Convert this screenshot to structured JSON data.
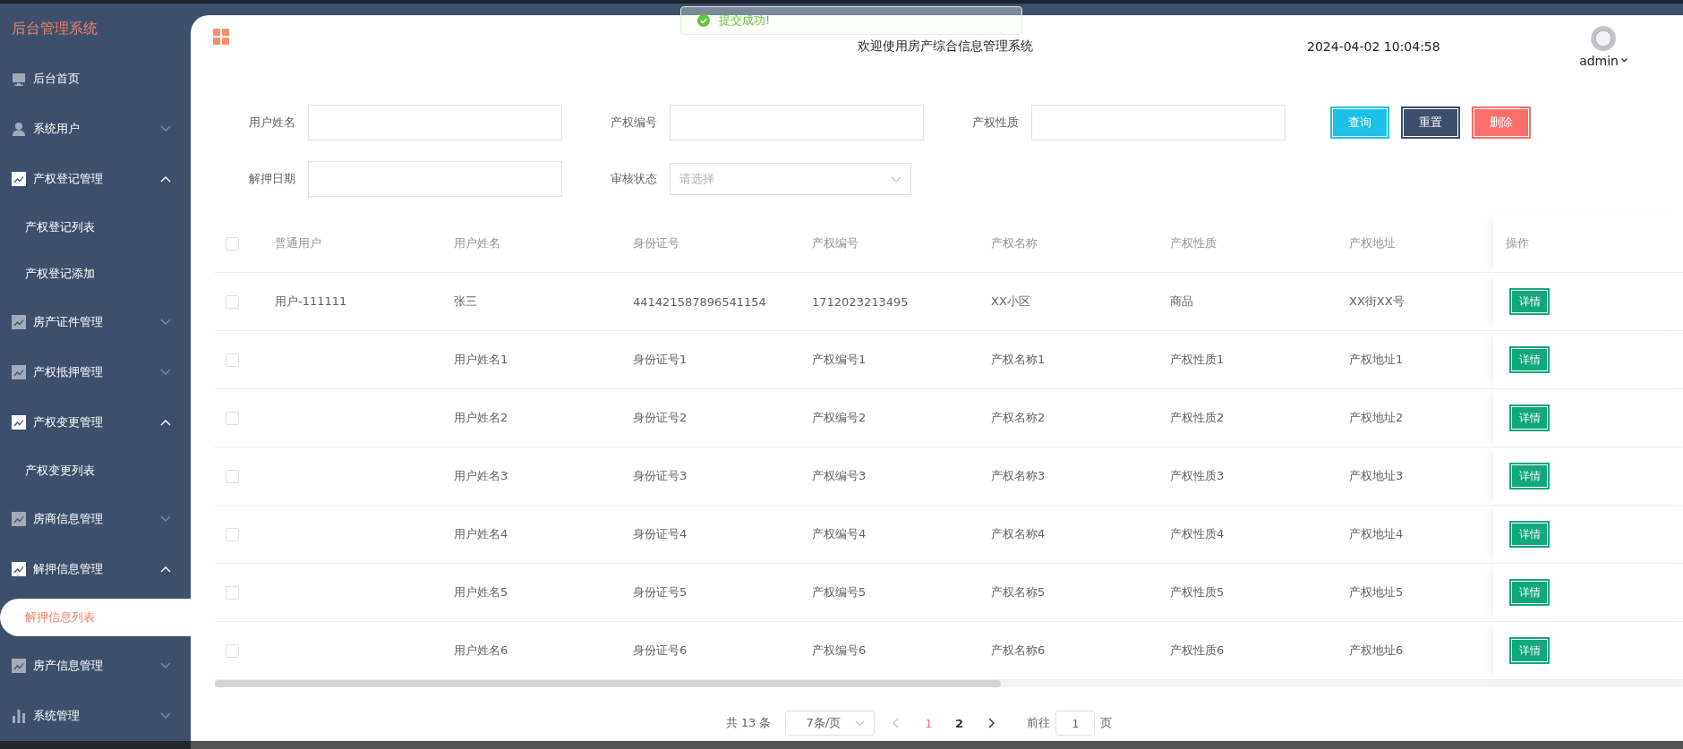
{
  "sidebar": {
    "title": "后台管理系统",
    "items": [
      {
        "label": "后台首页",
        "selected": false
      },
      {
        "label": "系统用户",
        "selected": false,
        "expanded": false
      },
      {
        "label": "产权登记管理",
        "selected": false,
        "expanded": true,
        "children": [
          {
            "label": "产权登记列表",
            "selected": false
          },
          {
            "label": "产权登记添加",
            "selected": false
          }
        ]
      },
      {
        "label": "房产证件管理",
        "selected": false,
        "expanded": false
      },
      {
        "label": "产权抵押管理",
        "selected": false,
        "expanded": false
      },
      {
        "label": "产权变更管理",
        "selected": false,
        "expanded": true,
        "children": [
          {
            "label": "产权变更列表",
            "selected": false
          }
        ]
      },
      {
        "label": "房商信息管理",
        "selected": false,
        "expanded": false
      },
      {
        "label": "解押信息管理",
        "selected": false,
        "expanded": true,
        "children": [
          {
            "label": "解押信息列表",
            "selected": true
          }
        ]
      },
      {
        "label": "房产信息管理",
        "selected": false,
        "expanded": false
      },
      {
        "label": "系统管理",
        "selected": false,
        "expanded": false
      }
    ]
  },
  "header": {
    "title": "欢迎使用房产综合信息管理系统",
    "datetime": "2024-04-02 10:04:58",
    "user": "admin"
  },
  "toast": {
    "message": "提交成功!"
  },
  "filters": [
    {
      "kind": "text",
      "label": "用户姓名"
    },
    {
      "kind": "text",
      "label": "产权编号"
    },
    {
      "kind": "text",
      "label": "产权性质"
    },
    {
      "kind": "text",
      "label": "解押日期"
    },
    {
      "kind": "select",
      "label": "审核状态",
      "placeholder": "请选择"
    }
  ],
  "buttons": [
    {
      "kind": "query",
      "label": "查询"
    },
    {
      "kind": "reset",
      "label": "重置"
    },
    {
      "kind": "delete",
      "label": "删除"
    }
  ],
  "table": {
    "all_checked": false,
    "columns": [
      "普通用户",
      "用户姓名",
      "身份证号",
      "产权编号",
      "产权名称",
      "产权性质",
      "产权地址",
      "操作"
    ],
    "rows": [
      {
        "checked": false,
        "cells": [
          "用户-111111",
          "张三",
          "441421587896541154",
          "1712023213495",
          "XX小区",
          "商品",
          "XX街XX号"
        ],
        "action": "详情"
      },
      {
        "checked": false,
        "cells": [
          "",
          "用户姓名1",
          "身份证号1",
          "产权编号1",
          "产权名称1",
          "产权性质1",
          "产权地址1"
        ],
        "action": "详情"
      },
      {
        "checked": false,
        "cells": [
          "",
          "用户姓名2",
          "身份证号2",
          "产权编号2",
          "产权名称2",
          "产权性质2",
          "产权地址2"
        ],
        "action": "详情"
      },
      {
        "checked": false,
        "cells": [
          "",
          "用户姓名3",
          "身份证号3",
          "产权编号3",
          "产权名称3",
          "产权性质3",
          "产权地址3"
        ],
        "action": "详情"
      },
      {
        "checked": false,
        "cells": [
          "",
          "用户姓名4",
          "身份证号4",
          "产权编号4",
          "产权名称4",
          "产权性质4",
          "产权地址4"
        ],
        "action": "详情"
      },
      {
        "checked": false,
        "cells": [
          "",
          "用户姓名5",
          "身份证号5",
          "产权编号5",
          "产权名称5",
          "产权性质5",
          "产权地址5"
        ],
        "action": "详情"
      },
      {
        "checked": false,
        "cells": [
          "",
          "用户姓名6",
          "身份证号6",
          "产权编号6",
          "产权名称6",
          "产权性质6",
          "产权地址6"
        ],
        "action": "详情"
      }
    ]
  },
  "pagination": {
    "total": "共 13 条",
    "page_size": "7条/页",
    "pages": [
      {
        "label": "1",
        "selected": true
      },
      {
        "label": "2",
        "selected": false
      }
    ],
    "goto_label": "前往",
    "goto_value": "1",
    "goto_suffix": "页"
  }
}
